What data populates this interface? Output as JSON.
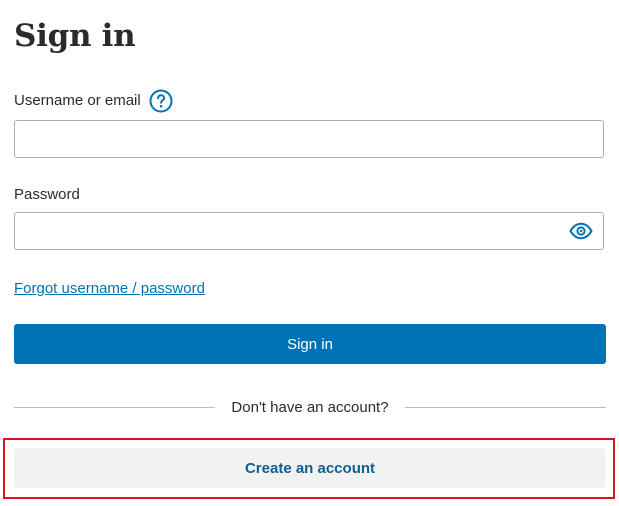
{
  "page": {
    "title": "Sign in"
  },
  "username": {
    "label": "Username or email",
    "value": "",
    "placeholder": "",
    "help_icon": "question-circle-icon"
  },
  "password": {
    "label": "Password",
    "value": "",
    "placeholder": "",
    "toggle_icon": "eye-icon"
  },
  "links": {
    "forgot": "Forgot username / password"
  },
  "buttons": {
    "sign_in": "Sign in",
    "create_account": "Create an account"
  },
  "divider": {
    "text": "Don't have an account?"
  },
  "colors": {
    "primary": "#0073b5",
    "secondary_bg": "#f2f2f2",
    "secondary_text": "#0a5f94",
    "highlight": "#d9141b"
  }
}
